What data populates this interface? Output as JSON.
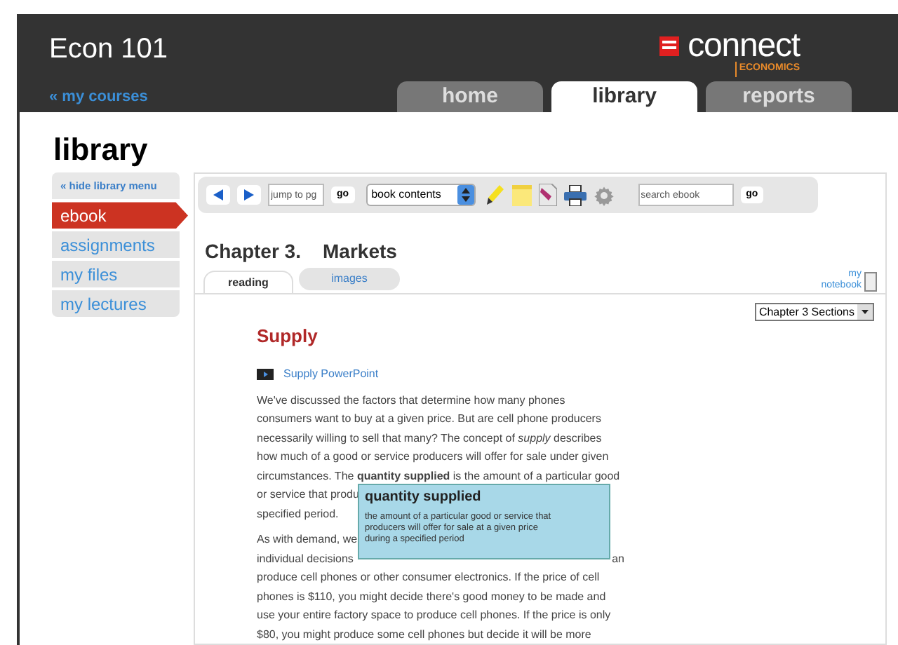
{
  "course": {
    "title": "Econ 101",
    "back_link": "« my courses"
  },
  "brand": {
    "name": "connect",
    "subject": "ECONOMICS"
  },
  "nav_tabs": [
    {
      "label": "home",
      "selected": false
    },
    {
      "label": "library",
      "selected": true
    },
    {
      "label": "reports",
      "selected": false
    }
  ],
  "page_title": "library",
  "sidebar": {
    "hide_link": "« hide library menu",
    "items": [
      {
        "label": "ebook",
        "selected": true
      },
      {
        "label": "assignments",
        "selected": false
      },
      {
        "label": "my files",
        "selected": false
      },
      {
        "label": "my lectures",
        "selected": false
      }
    ]
  },
  "toolbar": {
    "jump_placeholder": "jump to pg",
    "go": "go",
    "contents": "book contents",
    "search_placeholder": "search ebook",
    "search_go": "go"
  },
  "chapter": {
    "title": "Chapter 3.    Markets",
    "tabs": [
      {
        "label": "reading",
        "selected": true
      },
      {
        "label": "images",
        "selected": false
      }
    ],
    "notebook": [
      "my",
      "notebook"
    ],
    "sections": "Chapter 3 Sections"
  },
  "section": {
    "heading": "Supply",
    "media_link": "Supply PowerPoint",
    "paragraphs": [
      [
        [
          "We've discussed the factors that determine how many phones"
        ],
        [
          "consumers want to buy at a given price. But are cell phone producers"
        ],
        [
          "necessarily willing to sell that many? The concept of *supply* describes"
        ],
        [
          "how much of a good or service producers will offer for sale under given"
        ],
        [
          "circumstances. The **quantity supplied** is the amount of a particular good"
        ],
        [
          "or service that produ"
        ],
        [
          "specified period."
        ]
      ],
      [
        [
          "As with demand, we"
        ],
        [
          "individual decisions",
          "an"
        ],
        [
          "produce cell phones or other consumer electronics. If the price of cell"
        ],
        [
          "phones is $110, you might decide there's good money to be made and"
        ],
        [
          "use your entire factory space to produce cell phones. If the price is only"
        ],
        [
          "$80, you might produce some cell phones but decide it will be more"
        ]
      ]
    ]
  },
  "tooltip": {
    "term": "quantity supplied",
    "definition": "the amount of a particular good or service that producers will offer for sale at a given price during a specified period"
  }
}
